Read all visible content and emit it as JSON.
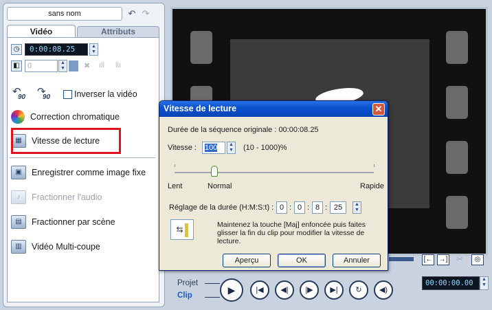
{
  "header": {
    "clip_name": "sans nom"
  },
  "tabs": [
    {
      "label": "Vidéo"
    },
    {
      "label": "Attributs"
    }
  ],
  "duration": {
    "value": "0:00:08.25"
  },
  "volume": {
    "value": "0"
  },
  "options": {
    "reverse_label": "Inverser la vidéo",
    "rotate_left_label": "90",
    "rotate_right_label": "90",
    "color_correction": "Correction chromatique",
    "playback_speed": "Vitesse de lecture",
    "save_still": "Enregistrer comme image fixe",
    "split_audio": "Fractionner l'audio",
    "split_by_scene": "Fractionner par scène",
    "multi_trim": "Vidéo Multi-coupe"
  },
  "transport": {
    "project_label": "Projet",
    "clip_label": "Clip"
  },
  "timecode": {
    "value": "00:00:00.00"
  },
  "dialog": {
    "title": "Vitesse de lecture",
    "original_duration": "Durée de la séquence originale : 00:00:08.25",
    "speed_label": "Vitesse :",
    "speed_value": "100",
    "speed_range": "(10 - 1000)%",
    "slider_min_label": "Lent",
    "slider_mid_label": "Normal",
    "slider_max_label": "Rapide",
    "slider_fraction": 0.2,
    "duration_label": "Réglage de la durée (H:M:S:t) :",
    "duration_fields": [
      "0",
      "0",
      "8",
      "25"
    ],
    "hint": "Maintenez la touche [Maj] enfoncée puis faites glisser la fin du clip pour modifier la vitesse de lecture.",
    "preview_button": "Aperçu",
    "ok_button": "OK",
    "cancel_button": "Annuler"
  }
}
